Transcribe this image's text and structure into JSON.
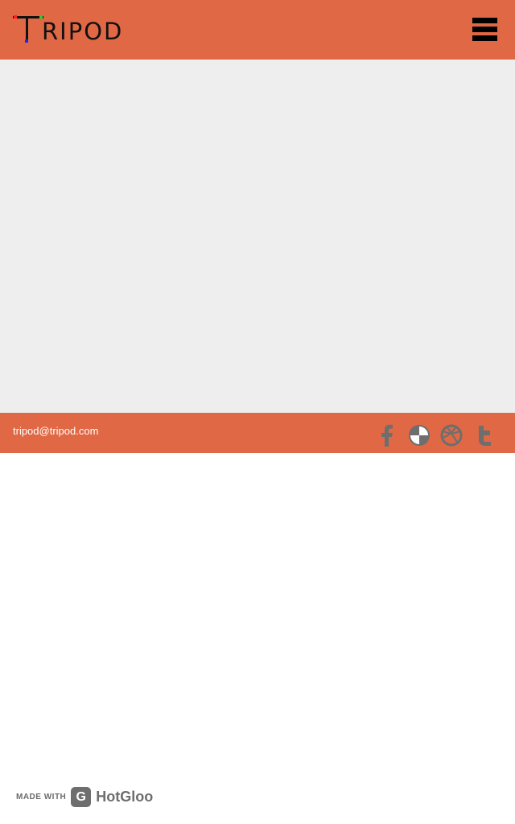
{
  "header": {
    "logo_text": "RIPOD",
    "logo_initial": "T",
    "menu_icon": "hamburger-icon"
  },
  "footer": {
    "email": "tripod@tripod.com",
    "social": [
      {
        "name": "facebook-icon"
      },
      {
        "name": "picasa-icon"
      },
      {
        "name": "dribbble-icon"
      },
      {
        "name": "tumblr-icon"
      }
    ]
  },
  "badge": {
    "made_with": "MADE WITH",
    "brand": "HotGloo"
  },
  "colors": {
    "brand": "#e06844",
    "hero_bg": "#eeeeee",
    "icon_gray": "#6e6e6e"
  }
}
